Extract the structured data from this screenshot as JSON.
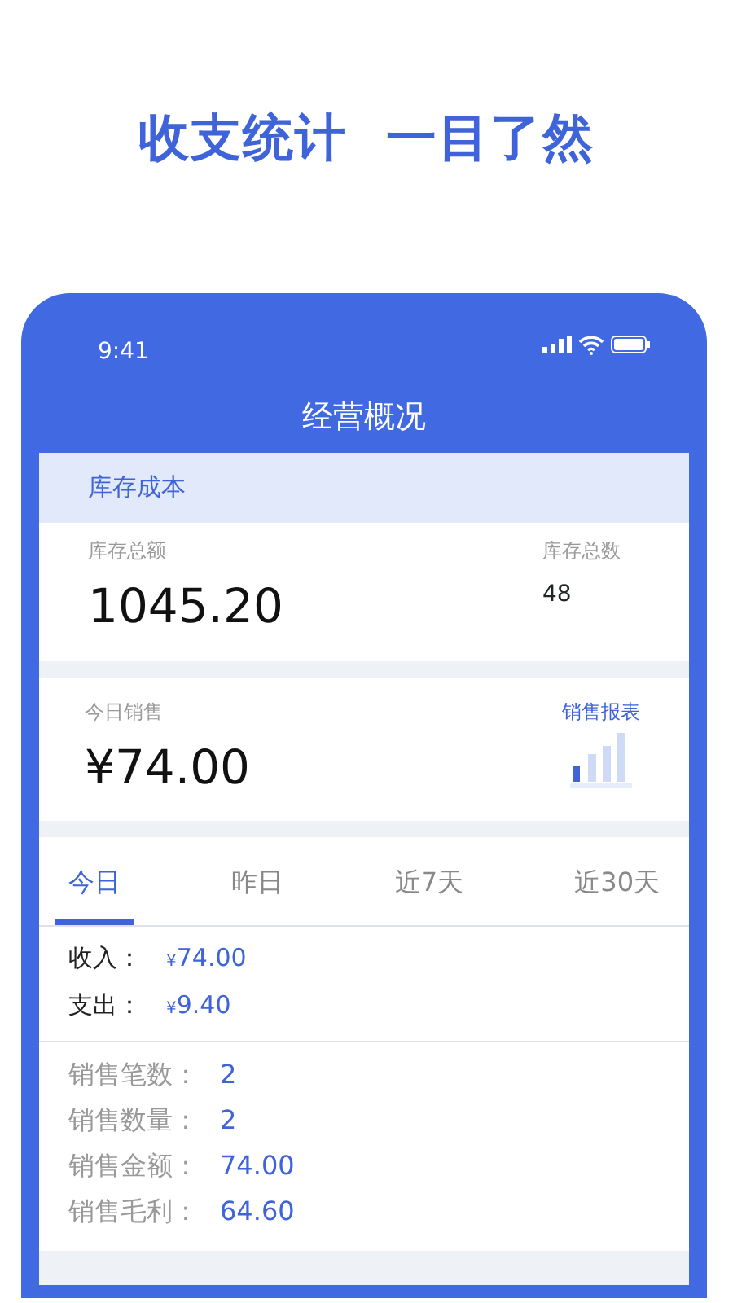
{
  "headline": "收支统计  一目了然",
  "status_bar": {
    "time": "9:41"
  },
  "app_title": "经营概况",
  "inventory": {
    "section_title": "库存成本",
    "total_amount_label": "库存总额",
    "total_amount": "1045.20",
    "total_count_label": "库存总数",
    "total_count": "48"
  },
  "today_sales": {
    "label": "今日销售",
    "amount": "¥74.00",
    "report_link": "销售报表"
  },
  "tabs": [
    {
      "label": "今日",
      "selected": true
    },
    {
      "label": "昨日",
      "selected": false
    },
    {
      "label": "近7天",
      "selected": false
    },
    {
      "label": "近30天",
      "selected": false
    }
  ],
  "cashflow": [
    {
      "label": "收入：",
      "currency": "¥",
      "value": "74.00"
    },
    {
      "label": "支出：",
      "currency": "¥",
      "value": "9.40"
    }
  ],
  "stats": [
    {
      "label": "销售笔数：",
      "value": "2"
    },
    {
      "label": "销售数量：",
      "value": "2"
    },
    {
      "label": "销售金额：",
      "value": "74.00"
    },
    {
      "label": "销售毛利：",
      "value": "64.60"
    }
  ]
}
